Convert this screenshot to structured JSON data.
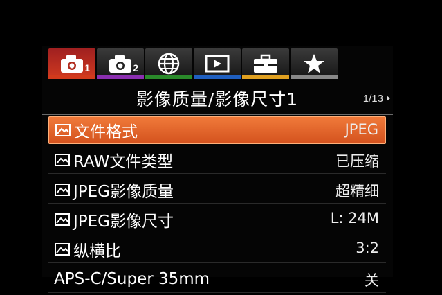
{
  "tabs": [
    {
      "icon": "camera-icon",
      "number": "1",
      "active": true,
      "stripe": "#d23a1c"
    },
    {
      "icon": "camera-icon",
      "number": "2",
      "active": false,
      "stripe": "#8b2fb0"
    },
    {
      "icon": "globe-icon",
      "number": "",
      "active": false,
      "stripe": "#2a8a2a"
    },
    {
      "icon": "playback-icon",
      "number": "",
      "active": false,
      "stripe": "#1f5fc0"
    },
    {
      "icon": "toolbox-icon",
      "number": "",
      "active": false,
      "stripe": "#e0a020"
    },
    {
      "icon": "star-icon",
      "number": "",
      "active": false,
      "stripe": "#888888"
    }
  ],
  "header": {
    "title": "影像质量/影像尺寸1",
    "page": "1/13"
  },
  "menu": [
    {
      "label": "文件格式",
      "value": "JPEG",
      "selected": true,
      "icon": "image-icon"
    },
    {
      "label": "RAW文件类型",
      "value": "已压缩",
      "selected": false,
      "icon": "image-icon"
    },
    {
      "label": "JPEG影像质量",
      "value": "超精细",
      "selected": false,
      "icon": "image-icon"
    },
    {
      "label": "JPEG影像尺寸",
      "value": "L: 24M",
      "selected": false,
      "icon": "image-icon"
    },
    {
      "label": "纵横比",
      "value": "3:2",
      "selected": false,
      "icon": "image-icon"
    },
    {
      "label": "APS-C/Super 35mm",
      "value": "关",
      "selected": false,
      "icon": ""
    }
  ],
  "colors": {
    "accent": "#e0642a",
    "background": "#050505"
  }
}
